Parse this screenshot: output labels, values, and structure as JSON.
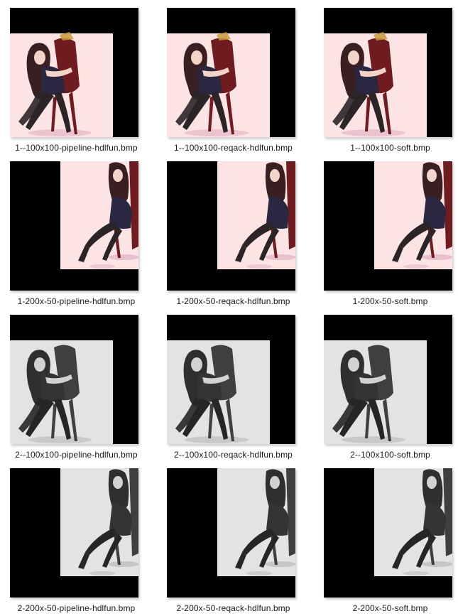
{
  "colors": {
    "frame": "#000000",
    "color_background": "#fde4e4",
    "color_hair": "#3a1f22",
    "color_chair": "#6e1c1f",
    "color_dress": "#2c2740",
    "color_legs": "#2b2527",
    "color_skin": "#f3d4c8",
    "color_shadow": "#e7bccb",
    "gray_background": "#e3e3e3",
    "gray_hair": "#2f2f2f",
    "gray_chair": "#3f3f3f",
    "gray_dress": "#343434",
    "gray_legs": "#262626",
    "gray_skin": "#d2d2d2",
    "gray_shadow": "#c2c2c2"
  },
  "files": [
    {
      "name": "1--100x100-pipeline-hdlfun.bmp",
      "icon": "image-file-thumbnail",
      "tone": "color",
      "offset": "top-left",
      "pose": "seated"
    },
    {
      "name": "1--100x100-reqack-hdlfun.bmp",
      "icon": "image-file-thumbnail",
      "tone": "color",
      "offset": "top-left",
      "pose": "seated"
    },
    {
      "name": "1--100x100-soft.bmp",
      "icon": "image-file-thumbnail",
      "tone": "color",
      "offset": "top-left",
      "pose": "seated"
    },
    {
      "name": "1-200x-50-pipeline-hdlfun.bmp",
      "icon": "image-file-thumbnail",
      "tone": "color",
      "offset": "right",
      "pose": "legs"
    },
    {
      "name": "1-200x-50-reqack-hdlfun.bmp",
      "icon": "image-file-thumbnail",
      "tone": "color",
      "offset": "right",
      "pose": "legs"
    },
    {
      "name": "1-200x-50-soft.bmp",
      "icon": "image-file-thumbnail",
      "tone": "color",
      "offset": "right",
      "pose": "legs"
    },
    {
      "name": "2--100x100-pipeline-hdlfun.bmp",
      "icon": "image-file-thumbnail",
      "tone": "gray",
      "offset": "top-left",
      "pose": "seated"
    },
    {
      "name": "2--100x100-reqack-hdlfun.bmp",
      "icon": "image-file-thumbnail",
      "tone": "gray",
      "offset": "top-left",
      "pose": "seated"
    },
    {
      "name": "2--100x100-soft.bmp",
      "icon": "image-file-thumbnail",
      "tone": "gray",
      "offset": "top-left",
      "pose": "seated"
    },
    {
      "name": "2-200x-50-pipeline-hdlfun.bmp",
      "icon": "image-file-thumbnail",
      "tone": "gray",
      "offset": "right",
      "pose": "legs"
    },
    {
      "name": "2-200x-50-reqack-hdlfun.bmp",
      "icon": "image-file-thumbnail",
      "tone": "gray",
      "offset": "right",
      "pose": "legs"
    },
    {
      "name": "2-200x-50-soft.bmp",
      "icon": "image-file-thumbnail",
      "tone": "gray",
      "offset": "right",
      "pose": "legs"
    }
  ]
}
